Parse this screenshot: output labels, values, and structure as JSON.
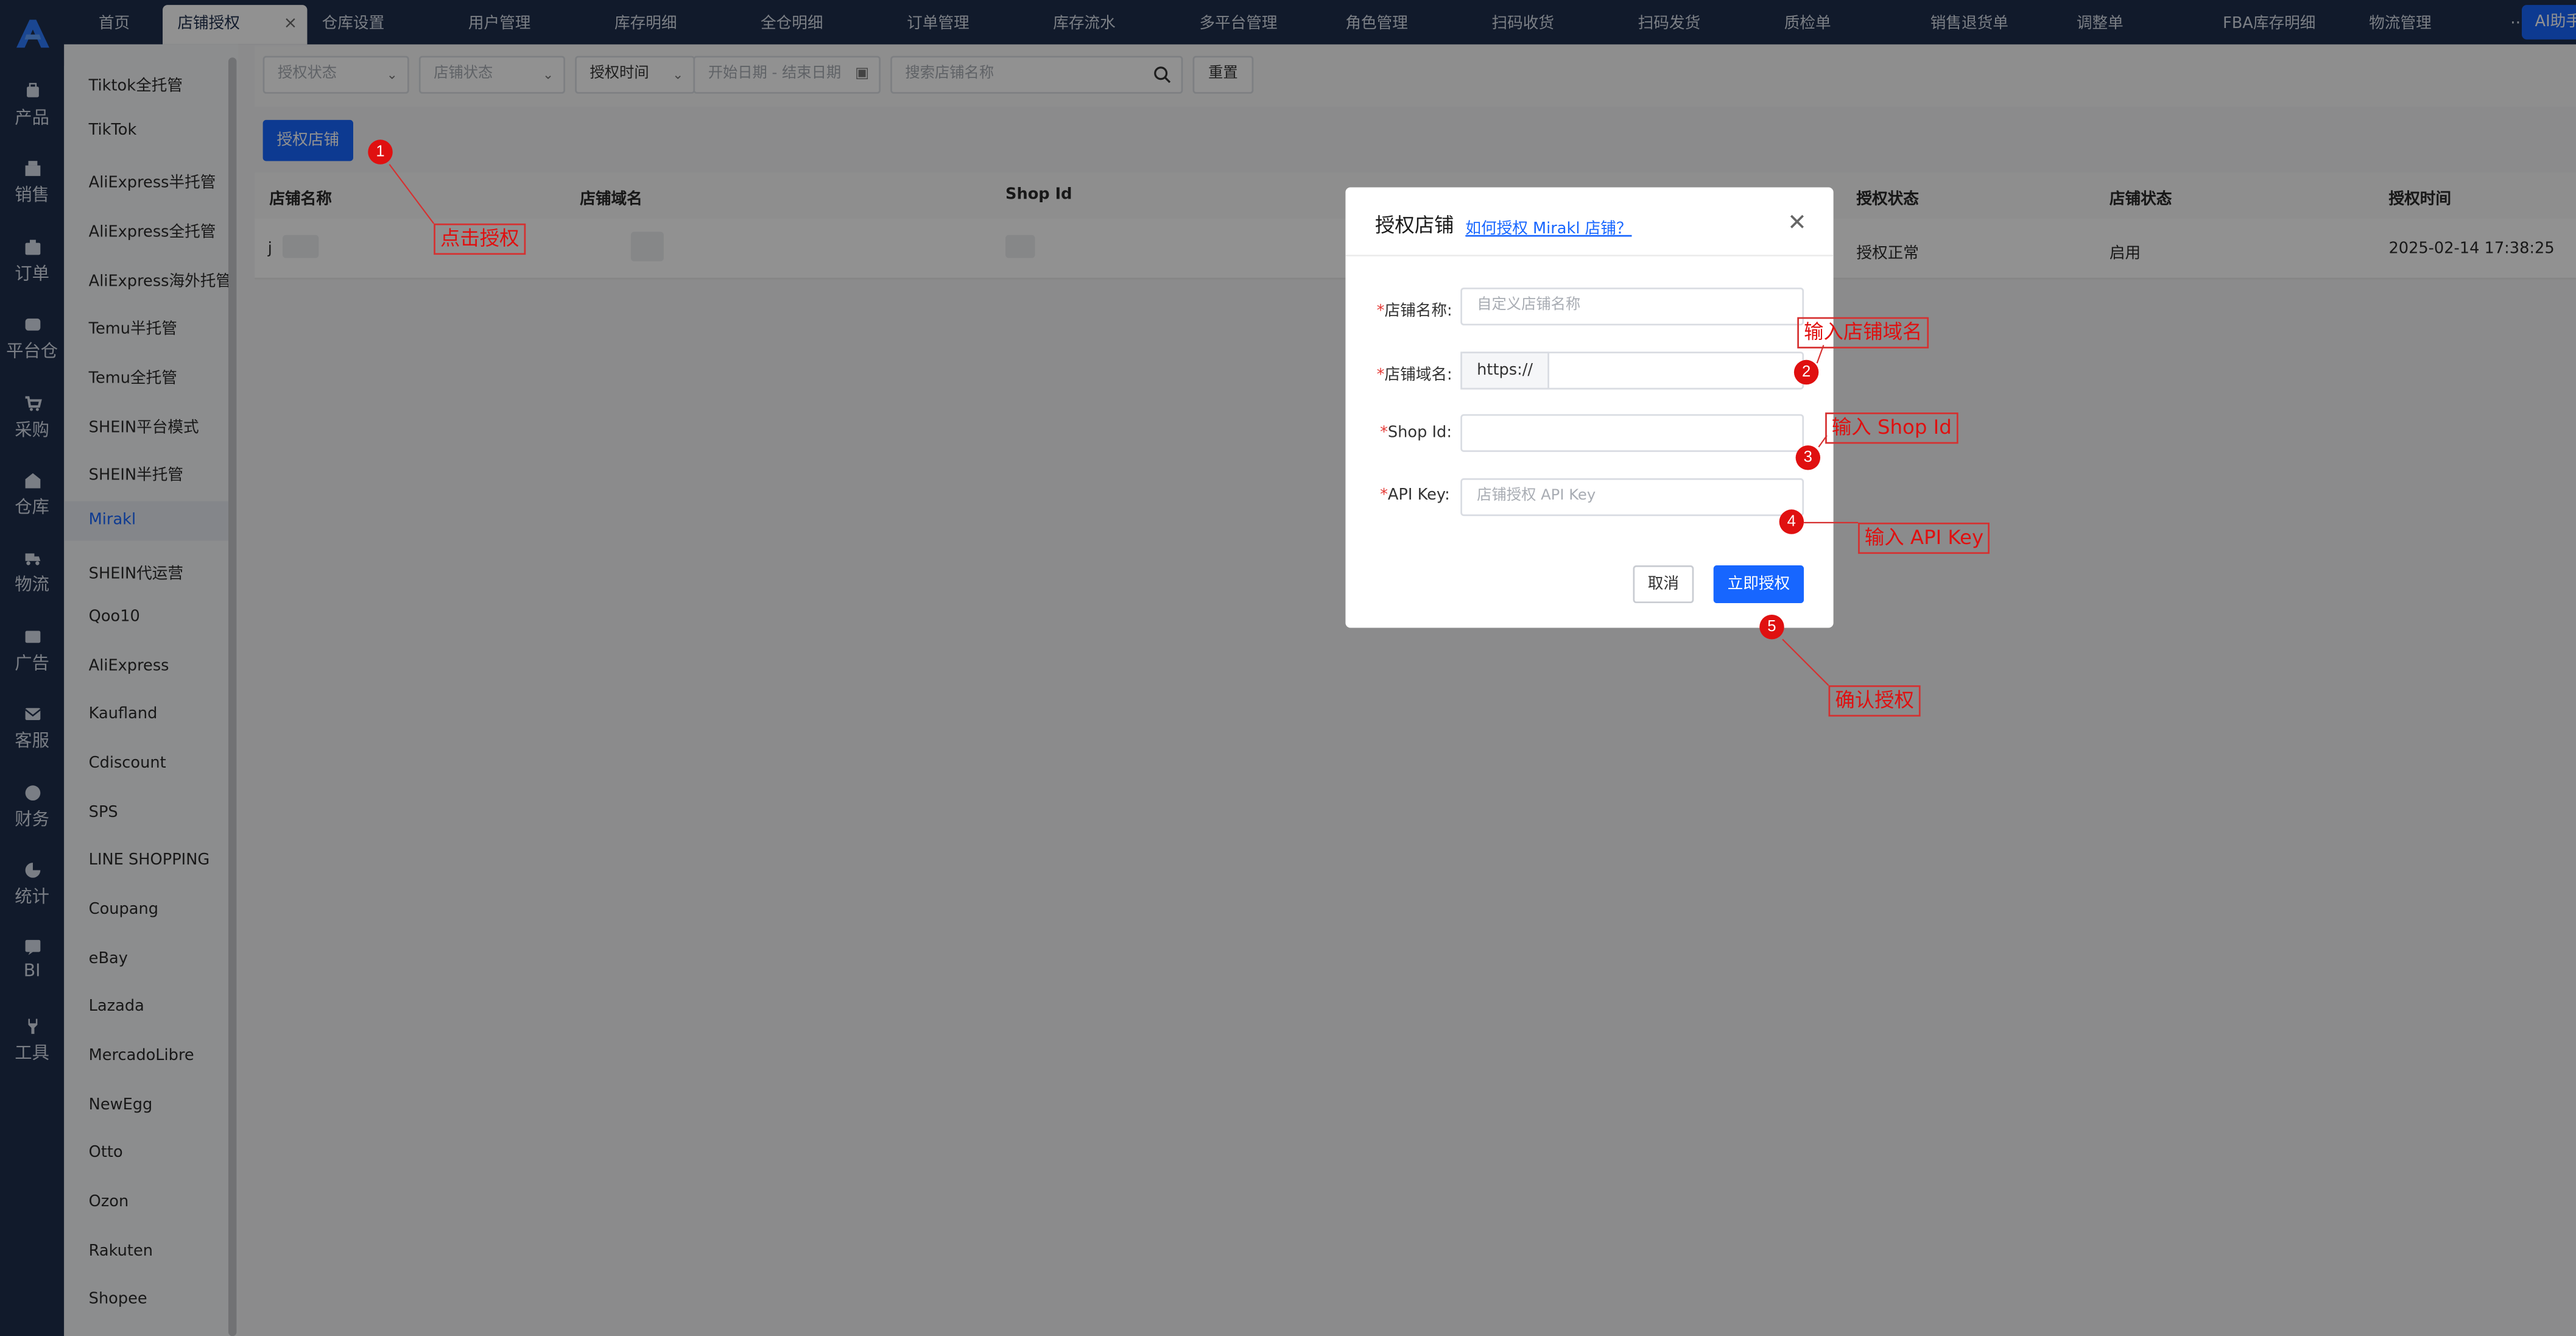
{
  "top_tabs": [
    {
      "label": "首页"
    },
    {
      "label": "店铺授权",
      "active": true
    },
    {
      "label": "仓库设置"
    },
    {
      "label": "用户管理"
    },
    {
      "label": "库存明细"
    },
    {
      "label": "全仓明细"
    },
    {
      "label": "订单管理"
    },
    {
      "label": "库存流水"
    },
    {
      "label": "多平台管理"
    },
    {
      "label": "角色管理"
    },
    {
      "label": "扫码收货"
    },
    {
      "label": "扫码发货"
    },
    {
      "label": "质检单"
    },
    {
      "label": "销售退货单"
    },
    {
      "label": "调整单"
    },
    {
      "label": "FBA库存明细"
    },
    {
      "label": "物流管理"
    }
  ],
  "tab_close_glyph": "×",
  "more_tabs": "··",
  "ai_helper": "AI助手",
  "left_nav": [
    {
      "label": "产品",
      "icon": "product-icon"
    },
    {
      "label": "销售",
      "icon": "sales-icon"
    },
    {
      "label": "订单",
      "icon": "order-icon"
    },
    {
      "label": "平台仓",
      "icon": "platform-warehouse-icon"
    },
    {
      "label": "采购",
      "icon": "cart-icon"
    },
    {
      "label": "仓库",
      "icon": "warehouse-icon"
    },
    {
      "label": "物流",
      "icon": "truck-icon"
    },
    {
      "label": "广告",
      "icon": "ad-icon"
    },
    {
      "label": "客服",
      "icon": "mail-icon"
    },
    {
      "label": "财务",
      "icon": "finance-icon"
    },
    {
      "label": "统计",
      "icon": "pie-chart-icon"
    },
    {
      "label": "BI",
      "icon": "bi-icon"
    },
    {
      "label": "工具",
      "icon": "wrench-icon"
    }
  ],
  "platforms": [
    "Tiktok全托管",
    "TikTok",
    "AliExpress半托管",
    "AliExpress全托管",
    "AliExpress海外托管",
    "Temu半托管",
    "Temu全托管",
    "SHEIN平台模式",
    "SHEIN半托管",
    "Mirakl",
    "SHEIN代运营",
    "Qoo10",
    "AliExpress",
    "Kaufland",
    "Cdiscount",
    "SPS",
    "LINE SHOPPING",
    "Coupang",
    "eBay",
    "Lazada",
    "MercadoLibre",
    "NewEgg",
    "Otto",
    "Ozon",
    "Rakuten",
    "Shopee"
  ],
  "active_platform": "Mirakl",
  "filters": {
    "auth_status": "授权状态",
    "shop_status": "店铺状态",
    "auth_time": "授权时间",
    "date_range": "开始日期  -  结束日期",
    "search_placeholder": "搜索店铺名称",
    "reset": "重置"
  },
  "authorize_button": "授权店铺",
  "table": {
    "headers": [
      "店铺名称",
      "店铺域名",
      "Shop Id",
      "授权状态",
      "店铺状态",
      "授权时间"
    ],
    "row": {
      "name_fragment": "j",
      "auth_status": "授权正常",
      "shop_status": "启用",
      "auth_time": "2025-02-14 17:38:25"
    }
  },
  "modal": {
    "title": "授权店铺",
    "help_link": "如何授权 Mirakl 店铺？",
    "close": "✕",
    "fields": {
      "shop_name_label": "店铺名称:",
      "shop_name_placeholder": "自定义店铺名称",
      "domain_label": "店铺域名:",
      "domain_prefix": "https://",
      "shop_id_label": "Shop Id:",
      "api_key_label": "API Key:",
      "api_key_placeholder": "店铺授权 API Key"
    },
    "required_mark": "*",
    "cancel": "取消",
    "confirm": "立即授权"
  },
  "annotations": [
    {
      "num": "1",
      "text": "点击授权"
    },
    {
      "num": "2",
      "text": "输入店铺域名"
    },
    {
      "num": "3",
      "text": "输入 Shop Id"
    },
    {
      "num": "4",
      "text": "输入 API Key"
    },
    {
      "num": "5",
      "text": "确认授权"
    }
  ],
  "colors": {
    "primary": "#1766ff",
    "sidebar": "#1f2f4d",
    "annotation": "#e01010"
  }
}
